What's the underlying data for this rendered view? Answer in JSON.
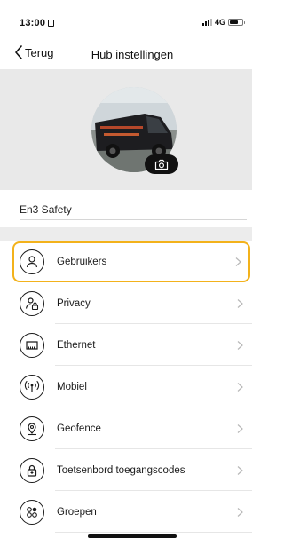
{
  "status_bar": {
    "time": "13:00",
    "network": "4G",
    "battery_level": 0.7
  },
  "nav": {
    "back_label": "Terug",
    "title": "Hub instellingen"
  },
  "hub": {
    "name": "En3 Safety",
    "avatar_icon": "van-photo",
    "camera_icon": "camera-icon"
  },
  "settings": {
    "items": [
      {
        "label": "Gebruikers",
        "icon": "user-icon",
        "highlighted": true
      },
      {
        "label": "Privacy",
        "icon": "user-lock-icon"
      },
      {
        "label": "Ethernet",
        "icon": "ethernet-icon"
      },
      {
        "label": "Mobiel",
        "icon": "antenna-icon"
      },
      {
        "label": "Geofence",
        "icon": "location-pin-icon"
      },
      {
        "label": "Toetsenbord toegangscodes",
        "icon": "keypad-lock-icon"
      },
      {
        "label": "Groepen",
        "icon": "groups-icon"
      }
    ]
  },
  "colors": {
    "highlight": "#f3b21b",
    "hero_background": "#e9e9e9",
    "separator": "#e6e6e6"
  }
}
